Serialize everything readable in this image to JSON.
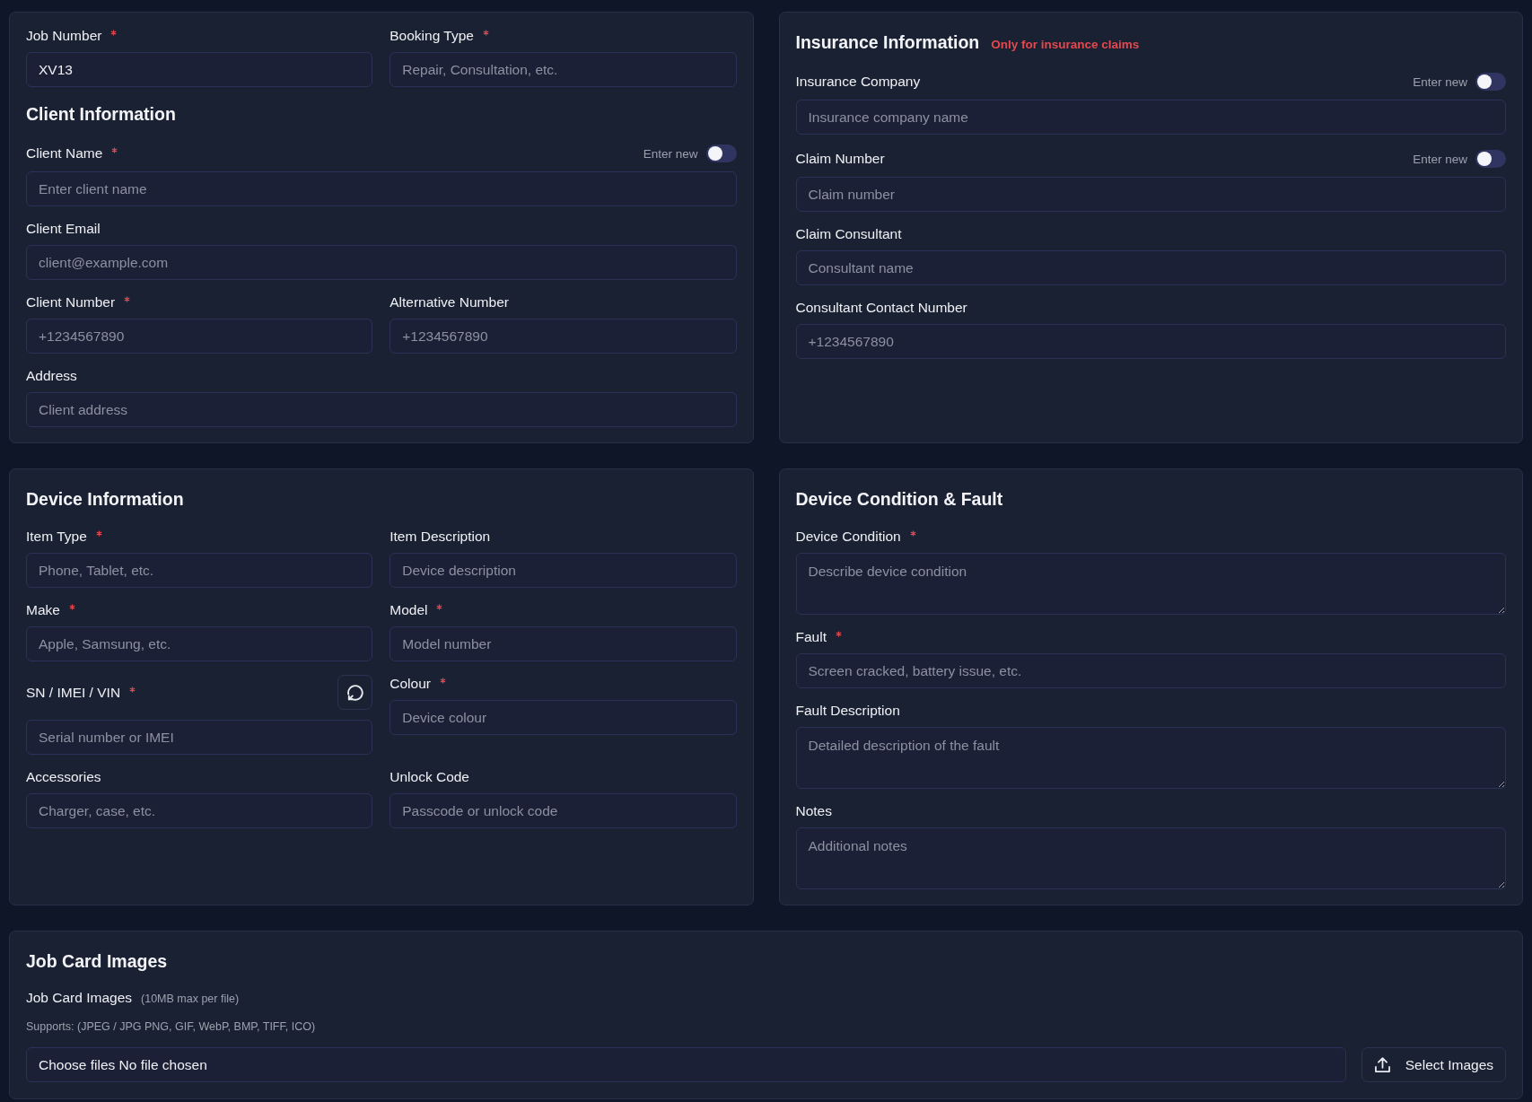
{
  "booking_panel": {
    "job_rows": [
      [
        {
          "label": "Job Number",
          "required": true,
          "kind": "input",
          "value": "XV13"
        },
        {
          "label": "Booking Type",
          "required": true,
          "kind": "input",
          "placeholder": "Repair, Consultation, etc."
        }
      ]
    ],
    "client_information": {
      "title": "Client Information",
      "rows": [
        [
          {
            "label": "Client Name",
            "required": true,
            "kind": "input",
            "placeholder": "Enter client name",
            "toggle": {
              "label": "Enter new",
              "on": false
            }
          }
        ],
        [
          {
            "label": "Client Email",
            "required": false,
            "kind": "input",
            "placeholder": "client@example.com"
          }
        ],
        [
          {
            "label": "Client Number",
            "required": true,
            "kind": "input",
            "placeholder": "+1234567890"
          },
          {
            "label": "Alternative Number",
            "required": false,
            "kind": "input",
            "placeholder": "+1234567890"
          }
        ],
        [
          {
            "label": "Address",
            "required": false,
            "kind": "input",
            "placeholder": "Client address"
          }
        ]
      ]
    }
  },
  "insurance_information": {
    "title": "Insurance Information",
    "note": "Only for insurance claims",
    "rows": [
      [
        {
          "label": "Insurance Company",
          "required": false,
          "kind": "input",
          "placeholder": "Insurance company name",
          "toggle": {
            "label": "Enter new",
            "on": false
          }
        }
      ],
      [
        {
          "label": "Claim Number",
          "required": false,
          "kind": "input",
          "placeholder": "Claim number",
          "toggle": {
            "label": "Enter new",
            "on": false
          }
        }
      ],
      [
        {
          "label": "Claim Consultant",
          "required": false,
          "kind": "input",
          "placeholder": "Consultant name"
        }
      ],
      [
        {
          "label": "Consultant Contact Number",
          "required": false,
          "kind": "input",
          "placeholder": "+1234567890"
        }
      ]
    ]
  },
  "device_information": {
    "title": "Device Information",
    "rows": [
      [
        {
          "label": "Item Type",
          "required": true,
          "kind": "input",
          "placeholder": "Phone, Tablet, etc."
        },
        {
          "label": "Item Description",
          "required": false,
          "kind": "input",
          "placeholder": "Device description"
        }
      ],
      [
        {
          "label": "Make",
          "required": true,
          "kind": "input",
          "placeholder": "Apple, Samsung, etc."
        },
        {
          "label": "Model",
          "required": true,
          "kind": "input",
          "placeholder": "Model number"
        }
      ],
      [
        {
          "label": "SN / IMEI / VIN",
          "required": true,
          "kind": "input_action",
          "placeholder": "Serial number or IMEI"
        },
        {
          "label": "Colour",
          "required": true,
          "kind": "input",
          "placeholder": "Device colour"
        }
      ],
      [
        {
          "label": "Accessories",
          "required": false,
          "kind": "input",
          "placeholder": "Charger, case, etc."
        },
        {
          "label": "Unlock Code",
          "required": false,
          "kind": "input",
          "placeholder": "Passcode or unlock code"
        }
      ]
    ]
  },
  "device_condition_fault": {
    "title": "Device Condition & Fault",
    "rows": [
      [
        {
          "label": "Device Condition",
          "required": true,
          "kind": "textarea",
          "placeholder": "Describe device condition"
        }
      ],
      [
        {
          "label": "Fault",
          "required": true,
          "kind": "input",
          "placeholder": "Screen cracked, battery issue, etc."
        }
      ],
      [
        {
          "label": "Fault Description",
          "required": false,
          "kind": "textarea",
          "placeholder": "Detailed description of the fault"
        }
      ],
      [
        {
          "label": "Notes",
          "required": false,
          "kind": "textarea",
          "placeholder": "Additional notes"
        }
      ]
    ]
  },
  "job_card_images": {
    "title": "Job Card Images",
    "label": "Job Card Images",
    "hint": "(10MB max per file)",
    "supports": "Supports: (JPEG / JPG PNG, GIF, WebP, BMP, TIFF, ICO)",
    "file_input": {
      "button_label": "Choose files",
      "status": "No file chosen"
    },
    "select_button": {
      "label": "Select Images"
    }
  }
}
